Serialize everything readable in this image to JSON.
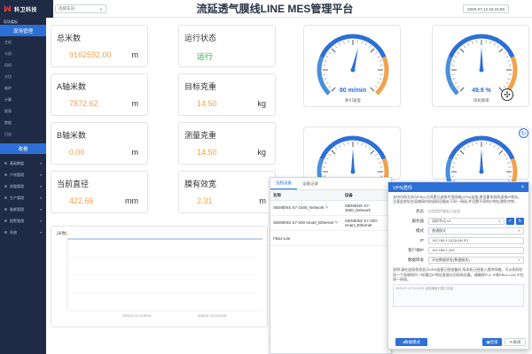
{
  "header": {
    "logo_text": "科卫科技",
    "select_placeholder": "选择车间",
    "title": "流延透气膜线LINE MES管理平台",
    "datetime": "2025-07-12 15:15:59"
  },
  "sidebar": {
    "section": "现场看板",
    "active": "现场管理",
    "items": [
      "主机",
      "卡机",
      "风机",
      "分切",
      "维护",
      "计算",
      "报表",
      "数据",
      "日志"
    ],
    "collapse": "收看",
    "menus": [
      "基础数据",
      "产线管理",
      "质量管理",
      "生产管理",
      "能耗管理",
      "报警管理",
      "系统"
    ]
  },
  "cards": [
    {
      "label": "总米数",
      "value": "9162592.00",
      "unit": "m"
    },
    {
      "label": "运行状态",
      "value": "运行",
      "unit": ""
    },
    {
      "label": "A轴米数",
      "value": "7872.62",
      "unit": "m"
    },
    {
      "label": "目标克重",
      "value": "14.50",
      "unit": "kg"
    },
    {
      "label": "B轴米数",
      "value": "0.00",
      "unit": "m"
    },
    {
      "label": "测量克重",
      "value": "14.50",
      "unit": "kg"
    },
    {
      "label": "当前直径",
      "value": "422.66",
      "unit": "mm"
    },
    {
      "label": "膜有效宽",
      "value": "2.31",
      "unit": "m"
    }
  ],
  "gauges": [
    {
      "value_text": "80 m/min",
      "caption": "牵引速度",
      "fraction": 0.55
    },
    {
      "value_text": "49.9 %",
      "caption": "风机频率",
      "fraction": 0.5
    },
    {
      "value_text": "",
      "caption": "",
      "fraction": 0.5
    },
    {
      "value_text": "",
      "caption": "",
      "fraction": 0.5
    }
  ],
  "chart": {
    "title": "[米数]",
    "x_ticks": [
      "2025-07-12 13:59:00",
      "2025-07-12 15:15:00"
    ]
  },
  "remote_panel": {
    "tabs": [
      "远程设备",
      "设备记录"
    ],
    "headers": [
      "名称",
      "设备"
    ],
    "rows": [
      {
        "name": "SIEMENS S7-1500_Network",
        "device": "SIEMENS S7-1500_Network"
      },
      {
        "name": "SIEMENS S7-200-smart_Ethernet",
        "device": "SIEMENS S7-200-smart_Ethernet"
      },
      {
        "name": "FBox-Lite",
        "device": ""
      }
    ]
  },
  "vpn": {
    "title": "VPN透传",
    "description": "支持内网主机与FBox之间建立虚拟专用网络(VPN)连接,建设重本机的虚拟IP地址。注意此地址在局域网内的虚拟设备处于同一网段,并设置不同的IP地址避免冲突。",
    "fields": [
      {
        "label": "状态",
        "value": "远程透传服务已连接"
      },
      {
        "label": "服务器",
        "value": "深圳节点-01"
      },
      {
        "label": "模式",
        "value": "普通模式"
      },
      {
        "label": "IP",
        "value": "192.168.1.242(LAN IP)"
      },
      {
        "label": "客户端IP",
        "value": "192.168.1.253"
      },
      {
        "label": "数据转发",
        "value": "开启数据转发(数据服务)"
      }
    ],
    "note": "说明:请在连接状态显示VPN连接已经准备好,所本机已经接入透传网络。可以如同在同一个局域网内一样通过IP地址直接访问现场设备。请确保PLC IP和FBox LAN IP在同一网段。",
    "log": "2025-07-12 15:15:09 远程通道已建立连接",
    "btn_mode": "数据模式",
    "btn_connect": "连接",
    "btn_close": "关闭"
  }
}
